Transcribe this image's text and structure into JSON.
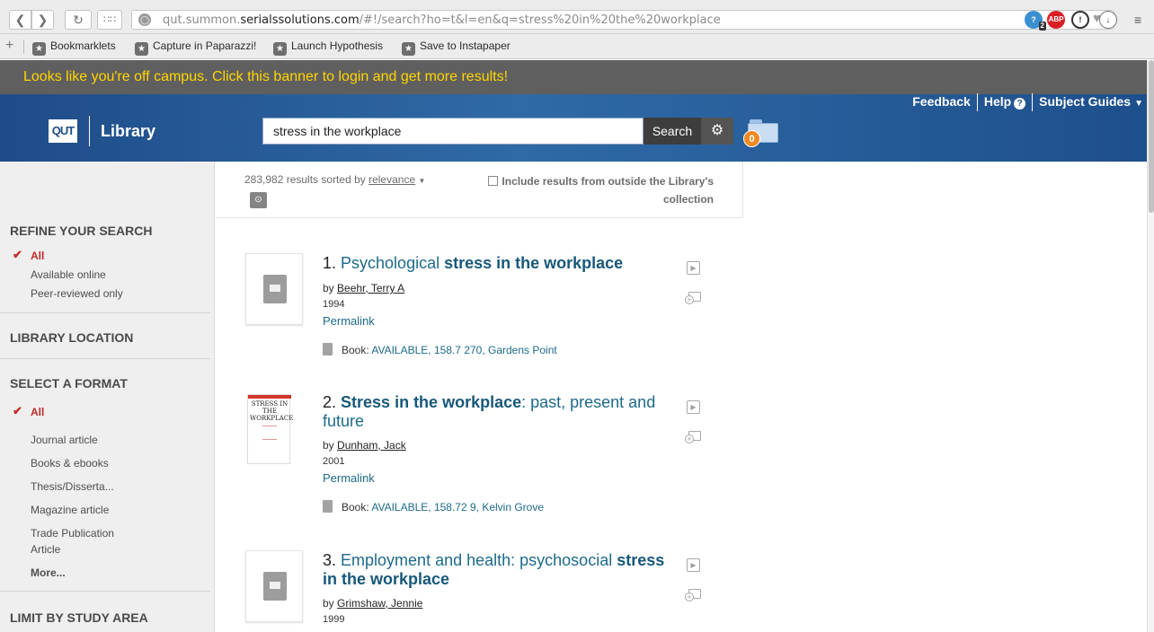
{
  "browser": {
    "url_prefix": "qut.summon.",
    "url_domain": "serialssolutions.com",
    "url_path": "/#!/search?ho=t&l=en&q=stress%20in%20the%20workplace",
    "ext_badge": "2",
    "abp_label": "ABP",
    "bookmarks": [
      "Bookmarklets",
      "Capture in Paparazzi!",
      "Launch Hypothesis",
      "Save to Instapaper"
    ]
  },
  "banner": {
    "text": "Looks like you're off campus. Click this banner to login and get more results!",
    "color": "#ffd600"
  },
  "header": {
    "logo": "QUT",
    "library": "Library",
    "search_value": "stress in the workplace",
    "search_button": "Search",
    "folder_count": "0",
    "links": {
      "feedback": "Feedback",
      "help": "Help",
      "subject_guides": "Subject Guides"
    }
  },
  "sidebar": {
    "refine_heading": "REFINE YOUR SEARCH",
    "refine_items": [
      "All",
      "Available online",
      "Peer-reviewed only"
    ],
    "location_heading": "LIBRARY LOCATION",
    "format_heading": "SELECT A FORMAT",
    "format_items": [
      "All",
      "Journal article",
      "Books & ebooks",
      "Thesis/Disserta...",
      "Magazine article",
      "Trade Publication",
      "Article"
    ],
    "more": "More...",
    "study_heading": "LIMIT BY STUDY AREA"
  },
  "results_header": {
    "count": "283,982 results sorted by",
    "sort": "relevance",
    "include_line1": "Include results from outside the Library's",
    "include_line2": "collection"
  },
  "results": [
    {
      "number": "1.",
      "title_plain": "Psychological ",
      "title_bold": "stress in the workplace",
      "title_rest": "",
      "by": "by",
      "author": "Beehr, Terry A",
      "year": "1994",
      "permalink": "Permalink",
      "avail_prefix": "Book:",
      "avail": "AVAILABLE, 158.7 270, Gardens Point"
    },
    {
      "number": "2.",
      "title_plain": "",
      "title_bold": "Stress in the workplace",
      "title_rest": ": past, present and future",
      "by": "by",
      "author": "Dunham, Jack",
      "year": "2001",
      "permalink": "Permalink",
      "avail_prefix": "Book:",
      "avail": "AVAILABLE, 158.72 9, Kelvin Grove",
      "cover_title": "STRESS IN THE WORKPLACE"
    },
    {
      "number": "3.",
      "title_plain": "Employment and health: psychosocial ",
      "title_bold": "stress in the workplace",
      "title_rest": "",
      "by": "by",
      "author": "Grimshaw, Jennie",
      "year": "1999"
    }
  ]
}
